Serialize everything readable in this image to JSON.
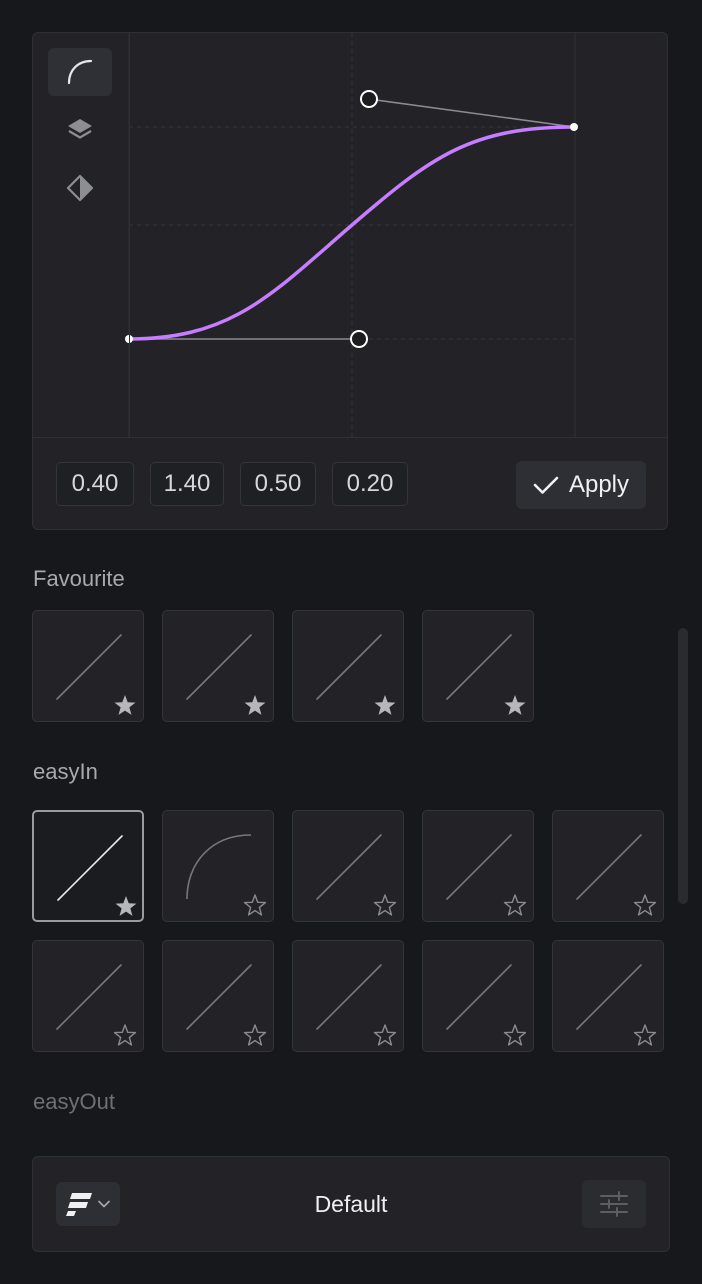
{
  "editor": {
    "tools": [
      {
        "icon": "curve-icon",
        "active": true
      },
      {
        "icon": "layers-icon",
        "active": false
      },
      {
        "icon": "contrast-diamond-icon",
        "active": false
      }
    ],
    "curve_color": "#c77dff",
    "values": [
      "0.40",
      "1.40",
      "0.50",
      "0.20"
    ],
    "apply_label": "Apply"
  },
  "sections": {
    "favourite_label": "Favourite",
    "easyin_label": "easyIn",
    "easyout_label": "easyOut"
  },
  "favourite_tiles": [
    {
      "curve": "linear",
      "starred": true
    },
    {
      "curve": "linear",
      "starred": true
    },
    {
      "curve": "linear",
      "starred": true
    },
    {
      "curve": "linear",
      "starred": true
    }
  ],
  "easyin_tiles": [
    {
      "curve": "linear",
      "starred": true,
      "selected": true
    },
    {
      "curve": "ease-out",
      "starred": false
    },
    {
      "curve": "linear",
      "starred": false
    },
    {
      "curve": "linear",
      "starred": false
    },
    {
      "curve": "linear",
      "starred": false
    },
    {
      "curve": "linear",
      "starred": false
    },
    {
      "curve": "linear",
      "starred": false
    },
    {
      "curve": "linear",
      "starred": false
    },
    {
      "curve": "linear",
      "starred": false
    },
    {
      "curve": "linear",
      "starred": false
    }
  ],
  "footer": {
    "brand_icon": "framer-logo-icon",
    "title": "Default",
    "settings_icon": "sliders-icon"
  }
}
